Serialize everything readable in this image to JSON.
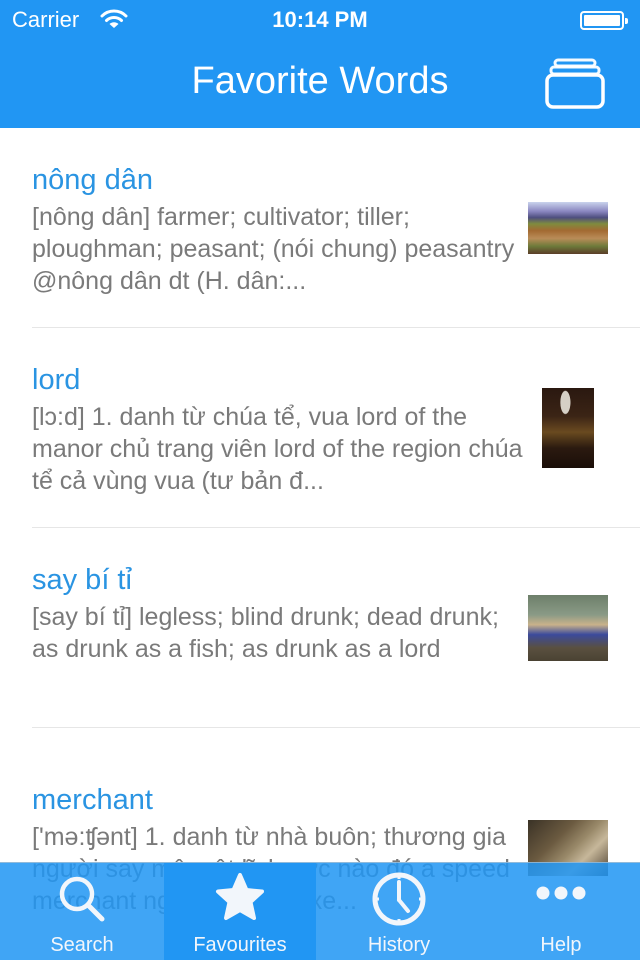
{
  "status_bar": {
    "carrier": "Carrier",
    "time": "10:14 PM",
    "wifi_icon": "wifi-icon",
    "battery_icon": "battery-full-icon"
  },
  "header": {
    "title": "Favorite Words",
    "right_button_icon": "stacked-cards-icon",
    "background_color": "#2196f3"
  },
  "entries": [
    {
      "word": "nông dân",
      "definition": "[nông dân] farmer; cultivator; tiller; ploughman; peasant; (nói chung) peasantry @nông dân dt (H. dân:...",
      "thumbnail": "farmland-landscape-image"
    },
    {
      "word": "lord",
      "definition": "[lɔ:d] 1. danh từ chúa tể, vua lord of the manor chủ trang viên lord of the region chúa tể cả vùng vua (tư bản đ...",
      "thumbnail": "portrait-of-lord-image"
    },
    {
      "word": "say bí tỉ",
      "definition": "[say bí tỉ] legless; blind drunk; dead drunk; as drunk as a fish; as drunk as a lord",
      "thumbnail": "drunk-men-image"
    },
    {
      "word": "merchant",
      "definition": "['mə:ʧənt] 1. danh từ nhà buôn; thương gia người say mê một lĩnh vực nào đó a speed merchant người thích lái xe...",
      "thumbnail": "merchant-painting-image"
    }
  ],
  "colors": {
    "word": "#2a94e2",
    "definition": "#7a7a7a",
    "tab_selected": "#2196f3"
  },
  "tabbar": {
    "selected_index": 1,
    "tabs": [
      {
        "label": "Search",
        "icon": "search-icon"
      },
      {
        "label": "Favourites",
        "icon": "star-icon"
      },
      {
        "label": "History",
        "icon": "clock-icon"
      },
      {
        "label": "Help",
        "icon": "more-dots-icon"
      }
    ]
  }
}
